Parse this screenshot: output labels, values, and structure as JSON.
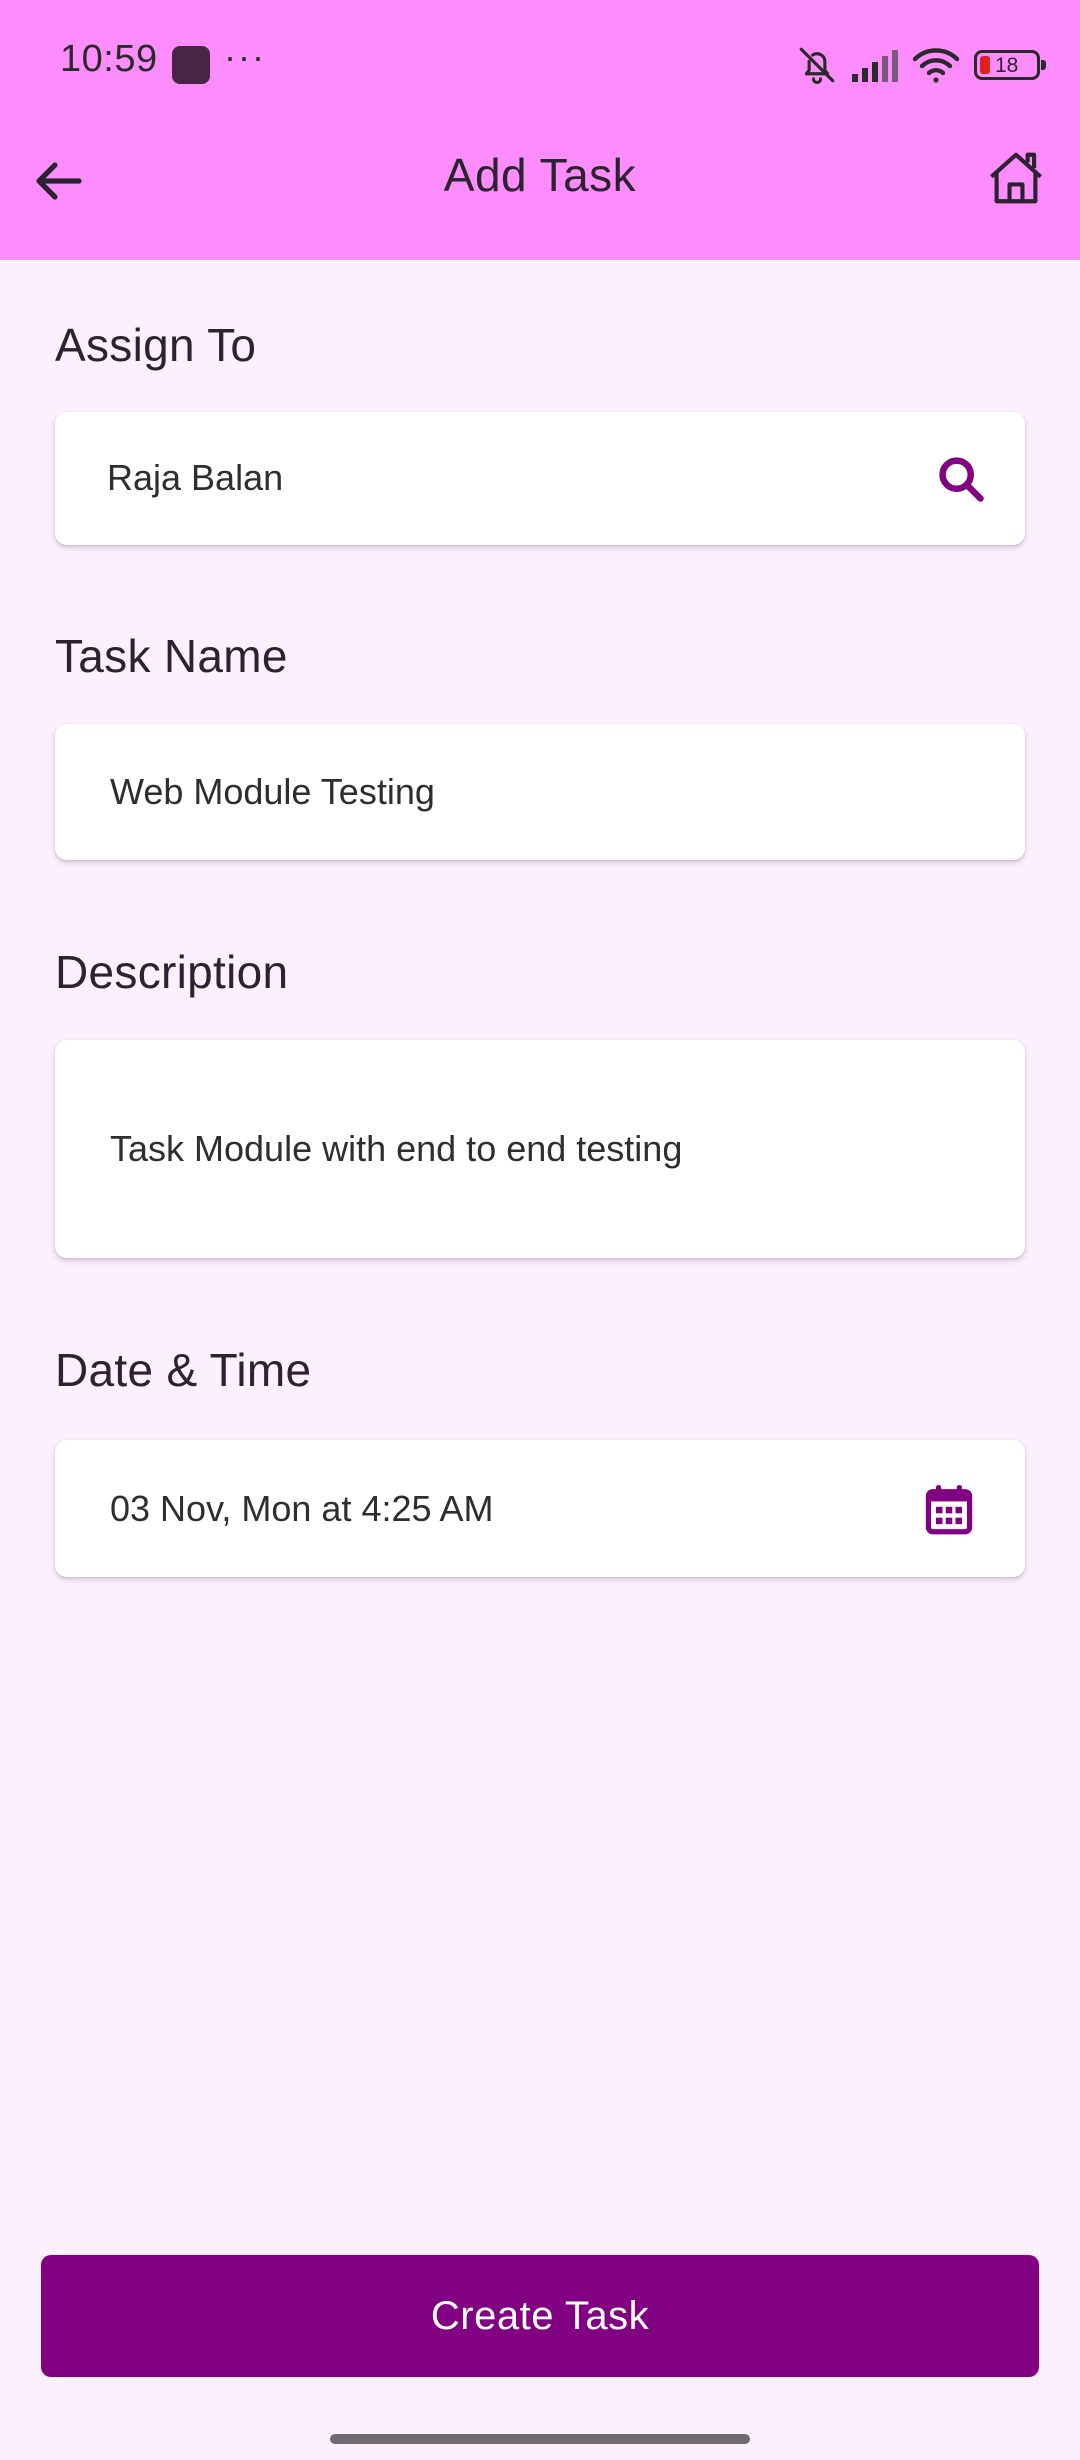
{
  "status_bar": {
    "time": "10:59",
    "more": "···",
    "battery_level": "18",
    "icons": [
      "app-square-icon",
      "bell-off-icon",
      "signal-icon",
      "wifi-icon",
      "battery-icon"
    ]
  },
  "header": {
    "title": "Add Task",
    "back_icon": "arrow-left-icon",
    "home_icon": "home-icon",
    "background_color": "#fd8cfd"
  },
  "form": {
    "assign_to": {
      "label": "Assign To",
      "value": "Raja Balan",
      "icon": "search-icon"
    },
    "task_name": {
      "label": "Task Name",
      "value": "Web Module Testing"
    },
    "description": {
      "label": "Description",
      "value": "Task Module with end to end testing"
    },
    "date_time": {
      "label": "Date & Time",
      "value": "03 Nov, Mon at 4:25 AM",
      "icon": "calendar-icon"
    }
  },
  "actions": {
    "create_label": "Create Task"
  },
  "colors": {
    "accent": "#820082",
    "page_background": "#fdf0fd",
    "card_background": "#ffffff"
  }
}
